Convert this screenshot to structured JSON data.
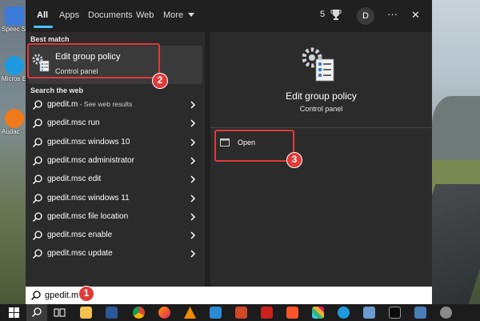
{
  "desktop": {
    "icons": [
      {
        "label": "Speec Shortc",
        "color": "#3c7bd6"
      },
      {
        "label": "Micros Edge",
        "color": "#1e9be0"
      },
      {
        "label": "Audac",
        "color": "#f07a1a"
      }
    ]
  },
  "search_tabs": [
    "All",
    "Apps",
    "Documents",
    "Web",
    "More"
  ],
  "topbar": {
    "points": "5",
    "avatar_initial": "D",
    "more_dots": "···",
    "close": "✕"
  },
  "results": {
    "best_match_heading": "Best match",
    "best_match": {
      "title": "Edit group policy",
      "subtitle": "Control panel"
    },
    "web_heading": "Search the web",
    "web_items": [
      {
        "text": "gpedit.m",
        "sub": " - See web results"
      },
      {
        "text": "gpedit.msc run",
        "sub": ""
      },
      {
        "text": "gpedit.msc windows 10",
        "sub": ""
      },
      {
        "text": "gpedit.msc administrator",
        "sub": ""
      },
      {
        "text": "gpedit.msc edit",
        "sub": ""
      },
      {
        "text": "gpedit.msc windows 11",
        "sub": ""
      },
      {
        "text": "gpedit.msc file location",
        "sub": ""
      },
      {
        "text": "gpedit.msc enable",
        "sub": ""
      },
      {
        "text": "gpedit.msc update",
        "sub": ""
      }
    ]
  },
  "preview": {
    "title": "Edit group policy",
    "subtitle": "Control panel",
    "actions": [
      {
        "label": "Open"
      }
    ]
  },
  "search_box": {
    "value": "gpedit.m"
  },
  "callouts": [
    "1",
    "2",
    "3"
  ],
  "colors": {
    "accent": "#4cc2ff",
    "annotation_red": "#e03a3a",
    "flyout_bg": "#202020",
    "pane_bg": "#2b2b2b"
  },
  "taskbar_icons": [
    "windows-start",
    "search",
    "task-view",
    "file-explorer",
    "word",
    "chrome",
    "firefox",
    "vlc",
    "vscode",
    "powerpoint",
    "acrobat",
    "brave",
    "slack",
    "edge",
    "virtualbox",
    "terminal",
    "rdp",
    "settings"
  ]
}
